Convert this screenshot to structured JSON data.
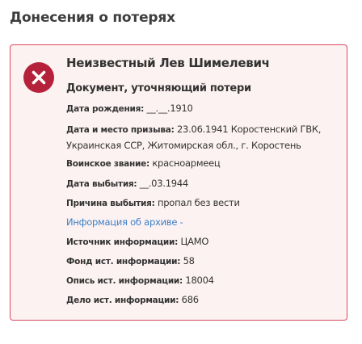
{
  "section_title": "Донесения о потерях",
  "colors": {
    "card_border": "#d9495e",
    "card_background": "#fdf2f2",
    "status_icon_background": "#b5213a",
    "link": "#3b7fc4"
  },
  "card": {
    "status_icon": "circle-x-icon",
    "person_name": "Неизвестный Лев Шимелевич",
    "document_type": "Документ, уточняющий потери",
    "fields": {
      "birth_date": {
        "label": "Дата рождения:",
        "value": "__.__.1910"
      },
      "draft": {
        "label": "Дата и место призыва:",
        "value": "23.06.1941 Коростенский ГВК, Украинская ССР, Житомирская обл., г. Коростень"
      },
      "rank": {
        "label": "Воинское звание:",
        "value": "красноармеец"
      },
      "leave_date": {
        "label": "Дата выбытия:",
        "value": "__.03.1944"
      },
      "leave_reason": {
        "label": "Причина выбытия:",
        "value": "пропал без вести"
      },
      "source": {
        "label": "Источник информации:",
        "value": "ЦАМО"
      },
      "fund": {
        "label": "Фонд ист. информации:",
        "value": "58"
      },
      "inventory": {
        "label": "Опись ист. информации:",
        "value": "18004"
      },
      "case": {
        "label": "Дело ист. информации:",
        "value": "686"
      }
    },
    "archive_link": "Информация об архиве -"
  }
}
